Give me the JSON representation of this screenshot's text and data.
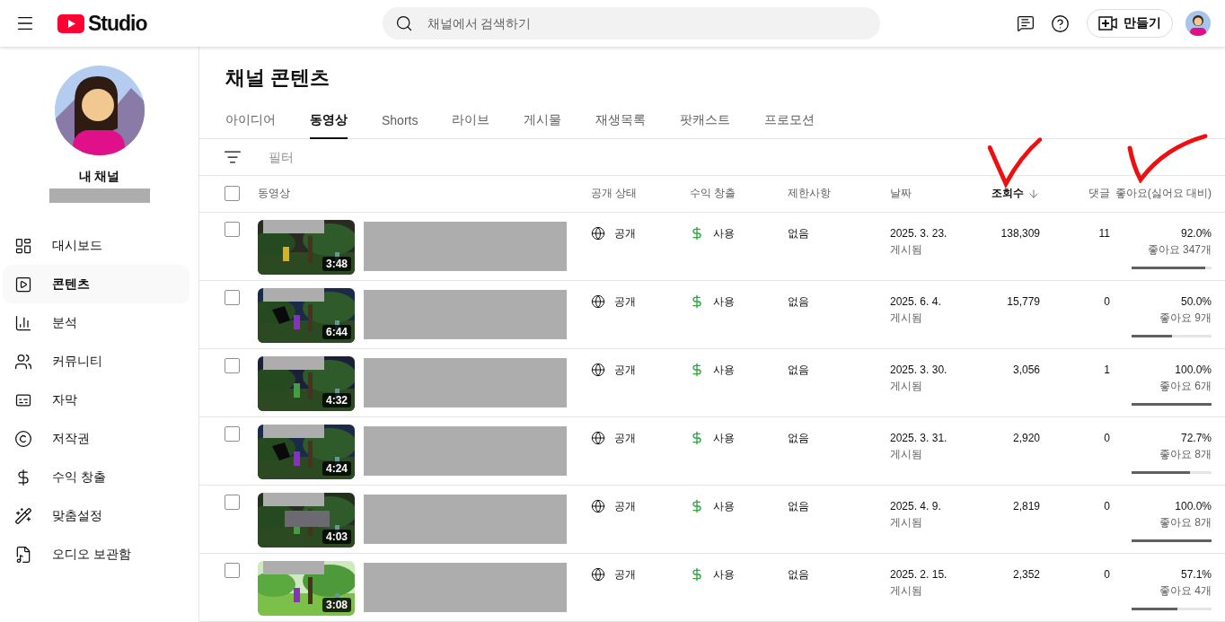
{
  "header": {
    "logo_text": "Studio",
    "search": {
      "placeholder": "채널에서 검색하기"
    },
    "create_button": "만들기"
  },
  "sidebar": {
    "channel_name": "내 채널",
    "items": [
      {
        "label": "대시보드",
        "selected": false
      },
      {
        "label": "콘텐츠",
        "selected": true
      },
      {
        "label": "분석",
        "selected": false
      },
      {
        "label": "커뮤니티",
        "selected": false
      },
      {
        "label": "자막",
        "selected": false
      },
      {
        "label": "저작권",
        "selected": false
      },
      {
        "label": "수익 창출",
        "selected": false
      },
      {
        "label": "맞춤설정",
        "selected": false
      },
      {
        "label": "오디오 보관함",
        "selected": false
      }
    ]
  },
  "page_title": "채널 콘텐츠",
  "tabs": [
    {
      "label": "아이디어",
      "selected": false
    },
    {
      "label": "동영상",
      "selected": true
    },
    {
      "label": "Shorts",
      "selected": false
    },
    {
      "label": "라이브",
      "selected": false
    },
    {
      "label": "게시물",
      "selected": false
    },
    {
      "label": "재생목록",
      "selected": false
    },
    {
      "label": "팟캐스트",
      "selected": false
    },
    {
      "label": "프로모션",
      "selected": false
    }
  ],
  "filter": {
    "placeholder": "필터"
  },
  "table": {
    "select_all": {
      "checked": false
    },
    "columns": [
      {
        "label": "동영상",
        "sorted": false
      },
      {
        "label": "공개 상태",
        "sorted": false
      },
      {
        "label": "수익 창출",
        "sorted": false
      },
      {
        "label": "제한사항",
        "sorted": false
      },
      {
        "label": "날짜",
        "sorted": false
      },
      {
        "label": "조회수",
        "sorted": true
      },
      {
        "label": "댓글",
        "sorted": false
      },
      {
        "label": "좋아요(싫어요 대비)",
        "sorted": false
      }
    ],
    "rows": [
      {
        "checked": false,
        "duration": "3:48",
        "visibility": "공개",
        "monetization": "사용",
        "restrictions": "없음",
        "date": "2025. 3. 23.",
        "status": "게시됨",
        "views": "138,309",
        "comments": "11",
        "likes_pct": "92.0%",
        "likes_count": "좋아요 347개",
        "level": 0.92
      },
      {
        "checked": false,
        "duration": "6:44",
        "visibility": "공개",
        "monetization": "사용",
        "restrictions": "없음",
        "date": "2025. 6. 4.",
        "status": "게시됨",
        "views": "15,779",
        "comments": "0",
        "likes_pct": "50.0%",
        "likes_count": "좋아요 9개",
        "level": 0.5
      },
      {
        "checked": false,
        "duration": "4:32",
        "visibility": "공개",
        "monetization": "사용",
        "restrictions": "없음",
        "date": "2025. 3. 30.",
        "status": "게시됨",
        "views": "3,056",
        "comments": "1",
        "likes_pct": "100.0%",
        "likes_count": "좋아요 6개",
        "level": 1
      },
      {
        "checked": false,
        "duration": "4:24",
        "visibility": "공개",
        "monetization": "사용",
        "restrictions": "없음",
        "date": "2025. 3. 31.",
        "status": "게시됨",
        "views": "2,920",
        "comments": "0",
        "likes_pct": "72.7%",
        "likes_count": "좋아요 8개",
        "level": 0.727
      },
      {
        "checked": false,
        "duration": "4:03",
        "visibility": "공개",
        "monetization": "사용",
        "restrictions": "없음",
        "date": "2025. 4. 9.",
        "status": "게시됨",
        "views": "2,819",
        "comments": "0",
        "likes_pct": "100.0%",
        "likes_count": "좋아요 8개",
        "level": 1
      },
      {
        "checked": false,
        "duration": "3:08",
        "visibility": "공개",
        "monetization": "사용",
        "restrictions": "없음",
        "date": "2025. 2. 15.",
        "status": "게시됨",
        "views": "2,352",
        "comments": "0",
        "likes_pct": "57.1%",
        "likes_count": "좋아요 4개",
        "level": 0.571
      }
    ]
  }
}
